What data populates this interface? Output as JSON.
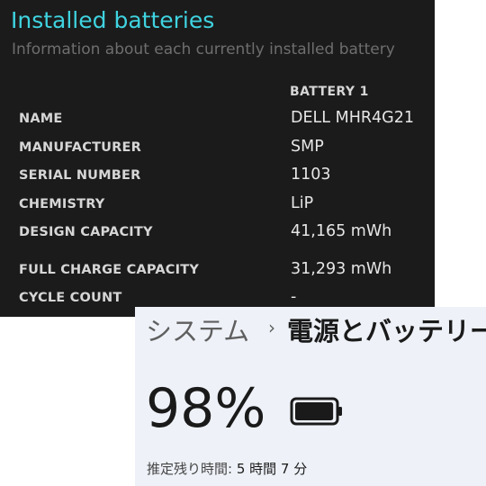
{
  "report": {
    "title": "Installed batteries",
    "subtitle": "Information about each currently installed battery",
    "column_header": "BATTERY 1",
    "rows": [
      {
        "label": "NAME",
        "value": "DELL MHR4G21"
      },
      {
        "label": "MANUFACTURER",
        "value": "SMP"
      },
      {
        "label": "SERIAL NUMBER",
        "value": "1103"
      },
      {
        "label": "CHEMISTRY",
        "value": "LiP"
      },
      {
        "label": "DESIGN CAPACITY",
        "value": "41,165 mWh"
      },
      {
        "label": "FULL CHARGE CAPACITY",
        "value": "31,293 mWh"
      },
      {
        "label": "CYCLE COUNT",
        "value": "-"
      }
    ],
    "colors": {
      "background": "#1b1b1b",
      "title": "#3fd3e0"
    }
  },
  "settings": {
    "breadcrumb_parent": "システム",
    "breadcrumb_separator": "›",
    "breadcrumb_current": "電源とバッテリー",
    "battery_percent": "98%",
    "battery_level": 0.98,
    "battery_icon": "battery-icon",
    "remaining_label": "推定残り時間:",
    "remaining_value": "5 時間 7 分",
    "colors": {
      "background": "#eef2f8"
    }
  }
}
